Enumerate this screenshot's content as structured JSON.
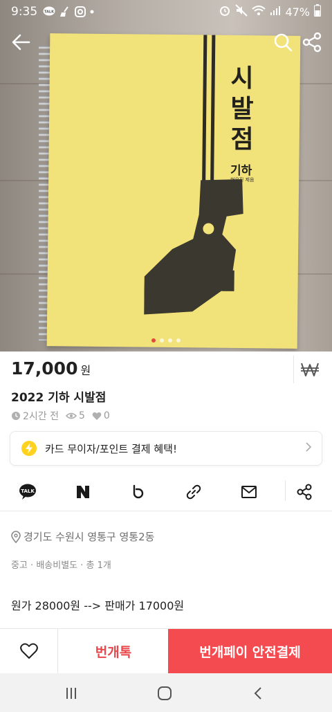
{
  "status_bar": {
    "time": "9:35",
    "battery": "47%",
    "left_icons": [
      "kakaotalk-talk-icon",
      "broom-icon",
      "instagram-icon",
      "dot-icon"
    ],
    "right_icons": [
      "alarm-icon",
      "mute-icon",
      "wifi-icon",
      "signal-icon",
      "battery-icon"
    ]
  },
  "photo": {
    "cover_title": "시발점",
    "cover_subtitle": "기하",
    "cover_author": "현우진 제음",
    "page_count": 4,
    "active_index": 0
  },
  "header": {
    "icons": [
      "back-arrow-icon",
      "search-icon",
      "share-icon"
    ]
  },
  "product": {
    "price": "17,000",
    "price_unit": "원",
    "title": "2022 기하 시발점",
    "time_ago": "2시간 전",
    "views": "5",
    "likes": "0"
  },
  "benefit": {
    "text": "카드 무이자/포인트 결제 혜택!"
  },
  "share": {
    "buttons": [
      "kakaotalk-share",
      "naver-share",
      "band-share",
      "link-copy",
      "mail-share",
      "share"
    ]
  },
  "info": {
    "location": "경기도 수원시 영통구 영통2동",
    "condition": "중고 · 배송비별도 · 총 1개",
    "description": "원가 28000원 --> 판매가 17000원"
  },
  "actions": {
    "chat_label": "번개톡",
    "pay_label": "번개페이 안전결제"
  },
  "colors": {
    "accent_red": "#f34b50",
    "chat_red": "#e8474b",
    "bolt_yellow": "#ffd21f",
    "cover_yellow": "#f2e27a"
  }
}
